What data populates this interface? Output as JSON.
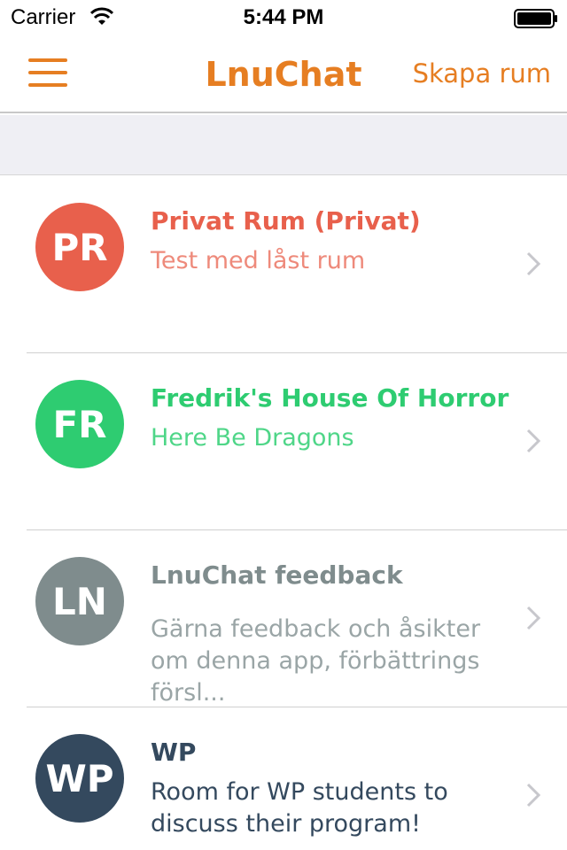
{
  "status_bar": {
    "carrier": "Carrier",
    "time": "5:44 PM"
  },
  "nav": {
    "title": "LnuChat",
    "action_label": "Skapa rum",
    "accent_color": "#e67e22"
  },
  "rooms": [
    {
      "initials": "PR",
      "title": "Privat Rum (Privat)",
      "subtitle": "Test med låst rum",
      "color": "#e8604c",
      "subtitle_color": "#ee8a7b"
    },
    {
      "initials": "FR",
      "title": "Fredrik's House Of Horror",
      "subtitle": "Here Be Dragons",
      "color": "#2ecc71",
      "subtitle_color": "#4fd688"
    },
    {
      "initials": "LN",
      "title": "LnuChat feedback",
      "subtitle": "Gärna feedback och åsikter om denna app, förbättrings försl...",
      "color": "#7f8c8d",
      "subtitle_color": "#9aa5a6"
    },
    {
      "initials": "WP",
      "title": "WP",
      "subtitle": "Room for WP students to discuss their program!",
      "color": "#34495e",
      "subtitle_color": "#34495e"
    }
  ]
}
